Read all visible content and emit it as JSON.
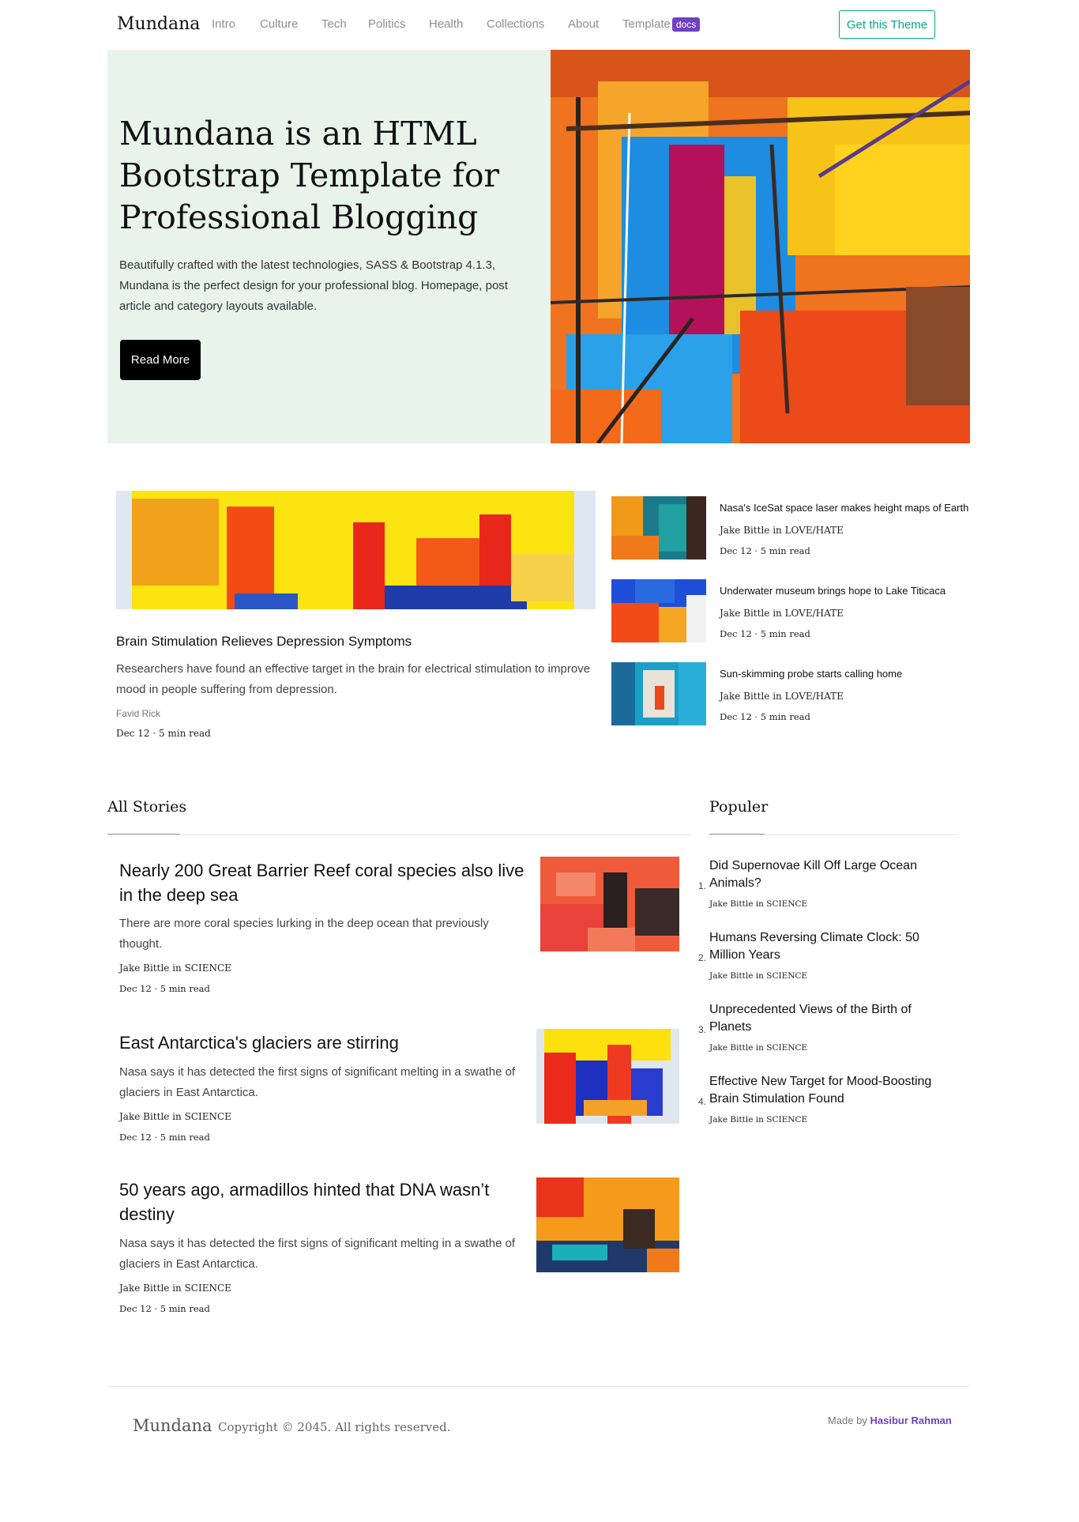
{
  "nav": {
    "brand": "Mundana",
    "links": [
      "Intro",
      "Culture",
      "Tech",
      "Politics",
      "Health",
      "Collections",
      "About",
      "Template"
    ],
    "docs_badge": "docs",
    "cta": "Get this Theme"
  },
  "hero": {
    "title": "Mundana is an HTML Bootstrap Template for Professional Blogging",
    "description": "Beautifully crafted with the latest technologies, SASS & Bootstrap 4.1.3, Mundana is the perfect design for your professional blog. Homepage, post article and category layouts available.",
    "button": "Read More"
  },
  "featured": {
    "title": "Brain Stimulation Relieves Depression Symptoms",
    "excerpt": "Researchers have found an effective target in the brain for electrical stimulation to improve mood in people suffering from depression.",
    "author": "Favid Rick",
    "meta": "Dec 12 · 5 min read"
  },
  "side_posts": [
    {
      "title": "Nasa's IceSat space laser makes height maps of Earth",
      "author": "Jake Bittle in LOVE/HATE",
      "meta": "Dec 12 · 5 min read"
    },
    {
      "title": "Underwater museum brings hope to Lake Titicaca",
      "author": "Jake Bittle in LOVE/HATE",
      "meta": "Dec 12 · 5 min read"
    },
    {
      "title": "Sun-skimming probe starts calling home",
      "author": "Jake Bittle in LOVE/HATE",
      "meta": "Dec 12 · 5 min read"
    }
  ],
  "all_stories": {
    "heading": "All Stories",
    "items": [
      {
        "title": "Nearly 200 Great Barrier Reef coral species also live in the deep sea",
        "excerpt": "There are more coral species lurking in the deep ocean that previously thought.",
        "author": "Jake Bittle in SCIENCE",
        "meta": "Dec 12 · 5 min read"
      },
      {
        "title": "East Antarctica's glaciers are stirring",
        "excerpt": "Nasa says it has detected the first signs of significant melting in a swathe of glaciers in East Antarctica.",
        "author": "Jake Bittle in SCIENCE",
        "meta": "Dec 12 · 5 min read"
      },
      {
        "title": "50 years ago, armadillos hinted that DNA wasn’t destiny",
        "excerpt": "Nasa says it has detected the first signs of significant melting in a swathe of glaciers in East Antarctica.",
        "author": "Jake Bittle in SCIENCE",
        "meta": "Dec 12 · 5 min read"
      }
    ]
  },
  "popular": {
    "heading": "Populer",
    "items": [
      {
        "num": "1.",
        "title": "Did Supernovae Kill Off Large Ocean Animals?",
        "author": "Jake Bittle in SCIENCE"
      },
      {
        "num": "2.",
        "title": "Humans Reversing Climate Clock: 50 Million Years",
        "author": "Jake Bittle in SCIENCE"
      },
      {
        "num": "3.",
        "title": "Unprecedented Views of the Birth of Planets",
        "author": "Jake Bittle in SCIENCE"
      },
      {
        "num": "4.",
        "title": "Effective New Target for Mood-Boosting Brain Stimulation Found",
        "author": "Jake Bittle in SCIENCE"
      }
    ]
  },
  "footer": {
    "brand": "Mundana",
    "copyright": "Copyright © 2045. All rights reserved.",
    "made_by_prefix": "Made by",
    "made_by_name": "Hasibur Rahman"
  },
  "colors": {
    "accent_green": "#03a87c",
    "accent_purple": "#6f42c1",
    "hero_bg": "#e8f3ec"
  }
}
